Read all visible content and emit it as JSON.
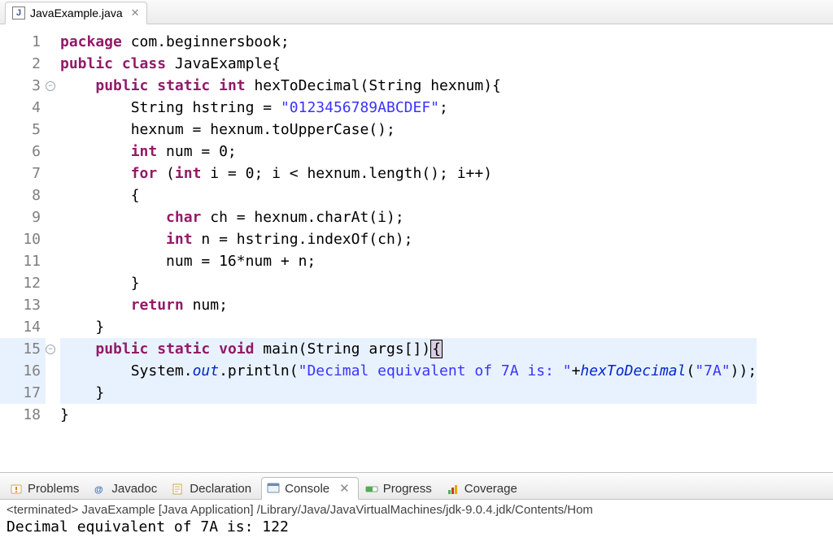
{
  "editor_tab": {
    "filename": "JavaExample.java",
    "close_glyph": "✕"
  },
  "gutter": {
    "line_count": 18,
    "fold_lines": [
      3,
      15
    ],
    "highlight_lines": [
      15,
      16,
      17
    ]
  },
  "code_lines": [
    {
      "n": 1,
      "tokens": [
        [
          "kw",
          "package"
        ],
        [
          "plain",
          " com.beginnersbook;"
        ]
      ]
    },
    {
      "n": 2,
      "tokens": [
        [
          "kw",
          "public"
        ],
        [
          "plain",
          " "
        ],
        [
          "kw",
          "class"
        ],
        [
          "plain",
          " JavaExample{"
        ]
      ]
    },
    {
      "n": 3,
      "tokens": [
        [
          "plain",
          "    "
        ],
        [
          "kw",
          "public"
        ],
        [
          "plain",
          " "
        ],
        [
          "kw",
          "static"
        ],
        [
          "plain",
          " "
        ],
        [
          "kw",
          "int"
        ],
        [
          "plain",
          " hexToDecimal(String hexnum){"
        ]
      ]
    },
    {
      "n": 4,
      "tokens": [
        [
          "plain",
          "        String hstring = "
        ],
        [
          "str",
          "\"0123456789ABCDEF\""
        ],
        [
          "plain",
          ";"
        ]
      ]
    },
    {
      "n": 5,
      "tokens": [
        [
          "plain",
          "        hexnum = hexnum.toUpperCase();"
        ]
      ]
    },
    {
      "n": 6,
      "tokens": [
        [
          "plain",
          "        "
        ],
        [
          "kw",
          "int"
        ],
        [
          "plain",
          " num = 0;"
        ]
      ]
    },
    {
      "n": 7,
      "tokens": [
        [
          "plain",
          "        "
        ],
        [
          "kw",
          "for"
        ],
        [
          "plain",
          " ("
        ],
        [
          "kw",
          "int"
        ],
        [
          "plain",
          " i = 0; i < hexnum.length(); i++)"
        ]
      ]
    },
    {
      "n": 8,
      "tokens": [
        [
          "plain",
          "        {"
        ]
      ]
    },
    {
      "n": 9,
      "tokens": [
        [
          "plain",
          "            "
        ],
        [
          "kw",
          "char"
        ],
        [
          "plain",
          " ch = hexnum.charAt(i);"
        ]
      ]
    },
    {
      "n": 10,
      "tokens": [
        [
          "plain",
          "            "
        ],
        [
          "kw",
          "int"
        ],
        [
          "plain",
          " n = hstring.indexOf(ch);"
        ]
      ]
    },
    {
      "n": 11,
      "tokens": [
        [
          "plain",
          "            num = 16*num + n;"
        ]
      ]
    },
    {
      "n": 12,
      "tokens": [
        [
          "plain",
          "        }"
        ]
      ]
    },
    {
      "n": 13,
      "tokens": [
        [
          "plain",
          "        "
        ],
        [
          "kw",
          "return"
        ],
        [
          "plain",
          " num;"
        ]
      ]
    },
    {
      "n": 14,
      "tokens": [
        [
          "plain",
          "    }"
        ]
      ]
    },
    {
      "n": 15,
      "hl": true,
      "tokens": [
        [
          "plain",
          "    "
        ],
        [
          "kw",
          "public"
        ],
        [
          "plain",
          " "
        ],
        [
          "kw",
          "static"
        ],
        [
          "plain",
          " "
        ],
        [
          "kw",
          "void"
        ],
        [
          "plain",
          " main(String args[])"
        ],
        [
          "cursor",
          "{"
        ]
      ]
    },
    {
      "n": 16,
      "hl": true,
      "tokens": [
        [
          "plain",
          "        System."
        ],
        [
          "ita",
          "out"
        ],
        [
          "plain",
          ".println("
        ],
        [
          "str",
          "\"Decimal equivalent of 7A is: \""
        ],
        [
          "plain",
          "+"
        ],
        [
          "ita",
          "hexToDecimal"
        ],
        [
          "plain",
          "("
        ],
        [
          "str",
          "\"7A\""
        ],
        [
          "plain",
          "));"
        ]
      ]
    },
    {
      "n": 17,
      "hl": true,
      "tokens": [
        [
          "plain",
          "    }"
        ]
      ]
    },
    {
      "n": 18,
      "tokens": [
        [
          "plain",
          "}"
        ]
      ]
    }
  ],
  "views": {
    "tabs": [
      {
        "id": "problems",
        "label": "Problems",
        "icon": "problems-icon"
      },
      {
        "id": "javadoc",
        "label": "Javadoc",
        "icon": "javadoc-icon"
      },
      {
        "id": "declaration",
        "label": "Declaration",
        "icon": "declaration-icon"
      },
      {
        "id": "console",
        "label": "Console",
        "icon": "console-icon",
        "active": true,
        "closable": true
      },
      {
        "id": "progress",
        "label": "Progress",
        "icon": "progress-icon"
      },
      {
        "id": "coverage",
        "label": "Coverage",
        "icon": "coverage-icon"
      }
    ]
  },
  "console": {
    "status": "<terminated> JavaExample [Java Application] /Library/Java/JavaVirtualMachines/jdk-9.0.4.jdk/Contents/Hom",
    "output": "Decimal equivalent of 7A is: 122"
  }
}
